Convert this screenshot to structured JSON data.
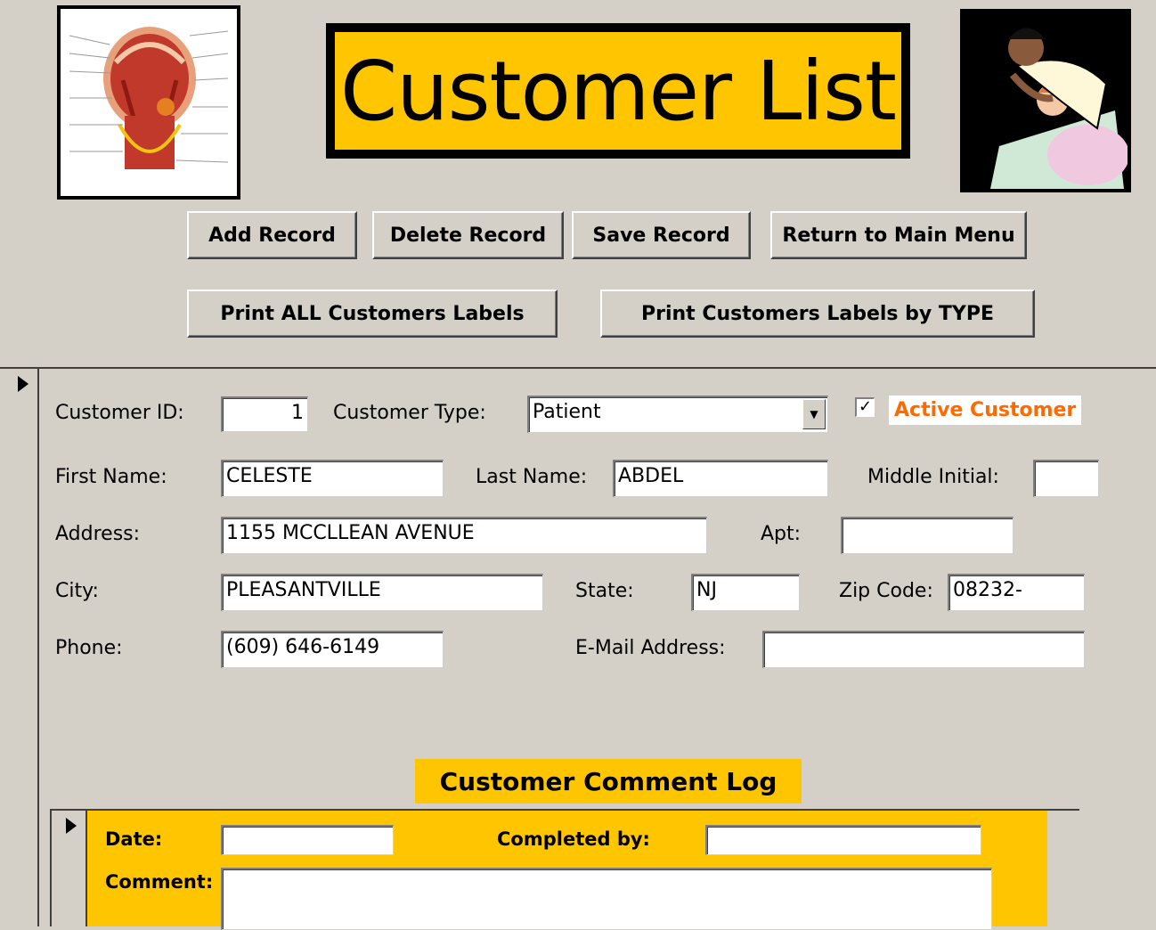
{
  "header": {
    "title": "Customer List",
    "left_image": "anatomy-head-illustration",
    "right_image": "nurse-patient-clipart"
  },
  "buttons": {
    "add": "Add Record",
    "delete": "Delete Record",
    "save": "Save Record",
    "return": "Return to Main Menu",
    "print_all": "Print ALL Customers Labels",
    "print_type": "Print Customers Labels by TYPE"
  },
  "form": {
    "customer_id": {
      "label": "Customer ID:",
      "value": "1"
    },
    "customer_type": {
      "label": "Customer Type:",
      "value": "Patient"
    },
    "active": {
      "label": "Active Customer",
      "checked": true
    },
    "first_name": {
      "label": "First Name:",
      "value": "CELESTE"
    },
    "last_name": {
      "label": "Last Name:",
      "value": "ABDEL"
    },
    "middle_initial": {
      "label": "Middle Initial:",
      "value": ""
    },
    "address": {
      "label": "Address:",
      "value": "1155 MCCLLEAN AVENUE"
    },
    "apt": {
      "label": "Apt:",
      "value": ""
    },
    "city": {
      "label": "City:",
      "value": "PLEASANTVILLE"
    },
    "state": {
      "label": "State:",
      "value": "NJ"
    },
    "zip": {
      "label": "Zip Code:",
      "value": "08232-"
    },
    "phone": {
      "label": "Phone:",
      "value": "(609) 646-6149"
    },
    "email": {
      "label": "E-Mail Address:",
      "value": ""
    }
  },
  "comment_log": {
    "title": "Customer Comment Log",
    "date_label": "Date:",
    "completed_label": "Completed by:",
    "comment_label": "Comment:",
    "date_value": "",
    "completed_value": "",
    "comment_value": ""
  },
  "colors": {
    "background": "#d4d0c8",
    "accent_yellow": "#ffc600",
    "active_orange": "#ff6a00"
  }
}
